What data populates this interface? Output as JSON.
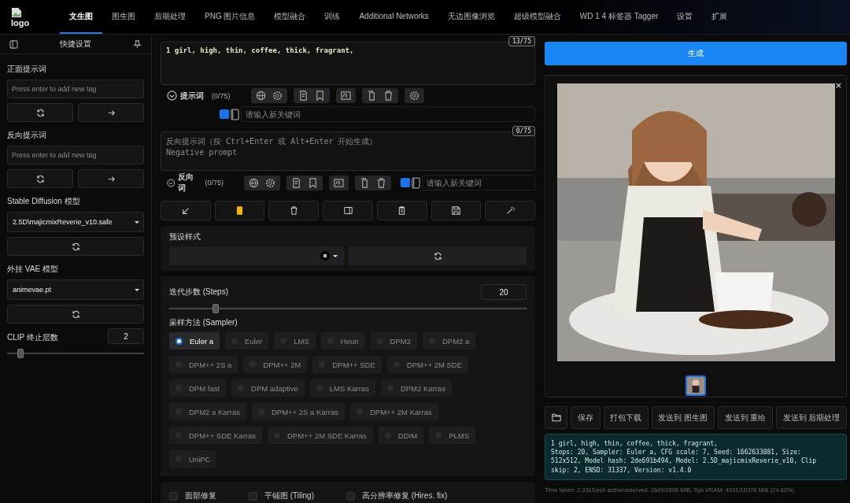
{
  "logo": {
    "text": "logo"
  },
  "tabs": [
    {
      "label": "文生图",
      "selected": true
    },
    {
      "label": "图生图",
      "selected": false
    },
    {
      "label": "后期处理",
      "selected": false
    },
    {
      "label": "PNG 图片信息",
      "selected": false
    },
    {
      "label": "模型融合",
      "selected": false
    },
    {
      "label": "训练",
      "selected": false
    },
    {
      "label": "Additional Networks",
      "selected": false
    },
    {
      "label": "无边图像浏览",
      "selected": false
    },
    {
      "label": "超级模型融合",
      "selected": false
    },
    {
      "label": "WD 1 4 标签器 Tagger",
      "selected": false
    },
    {
      "label": "设置",
      "selected": false
    },
    {
      "label": "扩展",
      "selected": false
    }
  ],
  "sidebar": {
    "title": "快捷设置",
    "positive": {
      "label": "正面提示词",
      "placeholder": "Press enter to add new tag"
    },
    "negative": {
      "label": "反向提示词",
      "placeholder": "Press enter to add new tag"
    },
    "model": {
      "label": "Stable Diffusion 模型",
      "value": "2.5D\\majicmixReverie_v10.safe"
    },
    "vae": {
      "label": "外挂 VAE 模型",
      "value": "animevae.pt"
    },
    "clip": {
      "label": "CLIP 终止层数",
      "value": "2",
      "level": 0.1
    }
  },
  "prompt": {
    "value": "1 girl, high, thin, coffee, thick, fragrant,",
    "counter": "13/75",
    "label": "提示词",
    "count": "(0/75)",
    "keyword": {
      "placeholder": "请输入新关键词",
      "checked": true
    }
  },
  "negative": {
    "placeholder": "反向提示词（按 Ctrl+Enter 或 Alt+Enter 开始生成）\nNegative prompt",
    "counter": "0/75",
    "label": "反向词",
    "count": "(0/75)",
    "keyword": {
      "placeholder": "请输入新关键词",
      "checked": true
    }
  },
  "styles": {
    "label": "预设样式"
  },
  "steps": {
    "label": "迭代步数 (Steps)",
    "value": "20",
    "level": 0.13
  },
  "sampler": {
    "label": "采样方法 (Sampler)",
    "options": [
      {
        "label": "Euler a",
        "selected": true
      },
      {
        "label": "Euler",
        "selected": false
      },
      {
        "label": "LMS",
        "selected": false
      },
      {
        "label": "Heun",
        "selected": false
      },
      {
        "label": "DPM2",
        "selected": false
      },
      {
        "label": "DPM2 a",
        "selected": false
      },
      {
        "label": "DPM++ 2S a",
        "selected": false
      },
      {
        "label": "DPM++ 2M",
        "selected": false
      },
      {
        "label": "DPM++ SDE",
        "selected": false
      },
      {
        "label": "DPM++ 2M SDE",
        "selected": false
      },
      {
        "label": "DPM fast",
        "selected": false
      },
      {
        "label": "DPM adaptive",
        "selected": false
      },
      {
        "label": "LMS Karras",
        "selected": false
      },
      {
        "label": "DPM2 Karras",
        "selected": false
      },
      {
        "label": "DPM2 a Karras",
        "selected": false
      },
      {
        "label": "DPM++ 2S a Karras",
        "selected": false
      },
      {
        "label": "DPM++ 2M Karras",
        "selected": false
      },
      {
        "label": "DPM++ SDE Karras",
        "selected": false
      },
      {
        "label": "DPM++ 2M SDE Karras",
        "selected": false
      },
      {
        "label": "DDIM",
        "selected": false
      },
      {
        "label": "PLMS",
        "selected": false
      },
      {
        "label": "UniPC",
        "selected": false
      }
    ]
  },
  "options": [
    {
      "label": "面部修复",
      "checked": false
    },
    {
      "label": "平铺图 (Tiling)",
      "checked": false
    },
    {
      "label": "高分辨率修复 (Hires. fix)",
      "checked": false
    }
  ],
  "generate": {
    "label": "生成"
  },
  "output_buttons": [
    {
      "kind": "folder"
    },
    {
      "kind": "text",
      "label": "保存"
    },
    {
      "kind": "text",
      "label": "打包下载"
    },
    {
      "kind": "text",
      "label": "发送到 图生图"
    },
    {
      "kind": "text",
      "label": "发送到 重绘"
    },
    {
      "kind": "text",
      "label": "发送到 后期处理"
    }
  ],
  "info": {
    "lines": [
      "1 girl, high, thin, coffee, thick, fragrant,",
      "Steps: 20, Sampler: Euler a, CFG scale: 7, Seed: 1662633081, Size:",
      "512x512, Model hash: 2de691b494, Model: 2.5D_majicmixReverie_v10, Clip",
      "skip: 2, ENSD: 31337, Version: v1.4.0"
    ]
  },
  "status": "Time taken: 2.33sTorch active/reserved: 2649/2806 MiB, Sys VRAM: 4031/16376 MiB (24.62%)"
}
